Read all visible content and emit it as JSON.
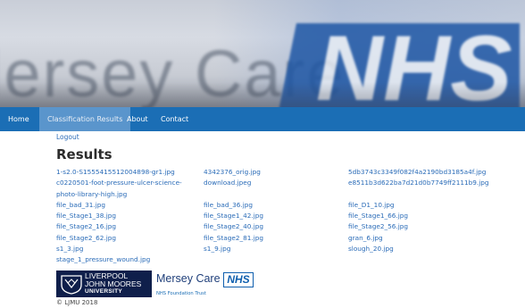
{
  "banner": {
    "faded_text": "lersey Care",
    "logo_text": "NHS",
    "colors": {
      "logo": "#1f57a5",
      "sky": "#c9ced8"
    }
  },
  "nav": {
    "items": [
      "Home",
      "Classification Results",
      "About",
      "Contact"
    ],
    "active_index": 1,
    "colors": {
      "bar": "#1b6eb5",
      "active": "#5a95cc"
    }
  },
  "logout_label": "Logout",
  "page_title": "Results",
  "results": {
    "col1": [
      "1-s2.0-S1555415512004898-gr1.jpg",
      "c0220501-foot-pressure-ulcer-science-",
      "photo-library-high.jpg",
      "file_bad_31.jpg",
      "file_Stage1_38.jpg",
      "file_Stage2_16.jpg",
      "file_Stage2_62.jpg",
      "s1_3.jpg",
      "stage_1_pressure_wound.jpg"
    ],
    "col2": [
      "4342376_orig.jpg",
      "download.jpeg",
      "",
      "file_bad_36.jpg",
      "file_Stage1_42.jpg",
      "file_Stage2_40.jpg",
      "file_Stage2_81.jpg",
      "s1_9.jpg"
    ],
    "col3": [
      "5db3743c3349f082f4a2190bd3185a4f.jpg",
      "e8511b3d622ba7d21d0b7749ff2111b9.jpg",
      "",
      "file_D1_10.jpg",
      "file_Stage1_66.jpg",
      "file_Stage2_56.jpg",
      "gran_6.jpg",
      "slough_20.jpg"
    ],
    "link_color": "#2b6cb8"
  },
  "footer": {
    "ljmu": {
      "line1": "LIVERPOOL",
      "line2": "JOHN MOORES",
      "line3": "UNIVERSITY"
    },
    "mersey_care": {
      "name": "Mersey Care",
      "nhs": "NHS",
      "trust": "NHS Foundation Trust"
    },
    "copyright": "© LJMU 2018"
  }
}
